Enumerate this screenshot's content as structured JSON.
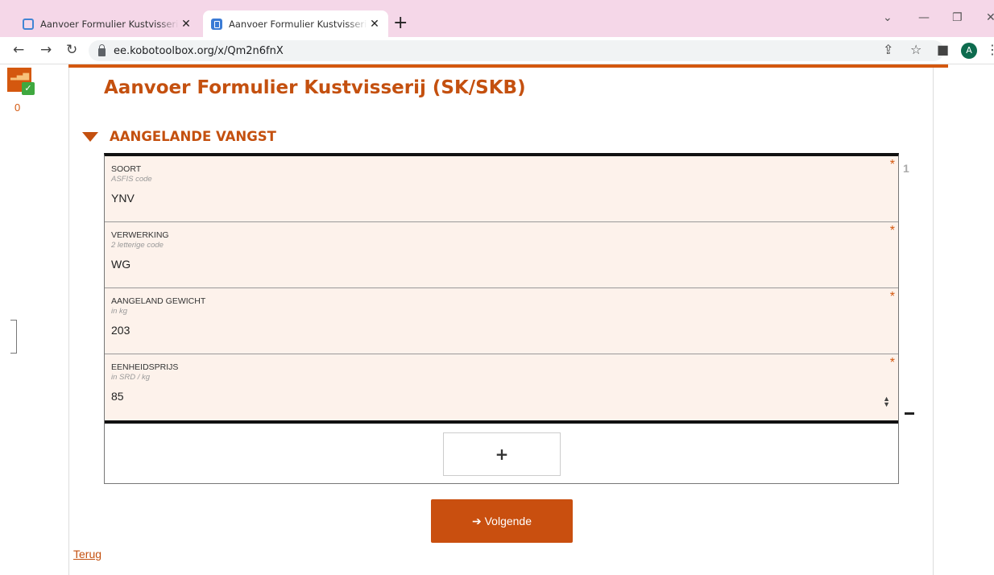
{
  "browser": {
    "tabs": [
      {
        "title": "Aanvoer Formulier Kustvisserij (SK",
        "close": "✕"
      },
      {
        "title": "Aanvoer Formulier Kustvisserij (SK",
        "close": "✕"
      }
    ],
    "new_tab": "+",
    "url": "ee.kobotoolbox.org/x/Qm2n6fnX",
    "avatar_letter": "A",
    "icons": [
      "back-icon",
      "forward-icon",
      "reload-icon",
      "lock-icon",
      "share-icon",
      "star-icon",
      "sidebar-icon",
      "menu-icon"
    ]
  },
  "sidebar": {
    "queue_count": "0"
  },
  "form": {
    "title": "Aanvoer Formulier Kustvisserij (SK/SKB)",
    "group_title": "AANGELANDE VANGST",
    "repeat_number": "1",
    "questions": [
      {
        "label": "SOORT",
        "hint": "ASFIS code",
        "value": "YNV",
        "required": "*"
      },
      {
        "label": "VERWERKING",
        "hint": "2 letterige code",
        "value": "WG",
        "required": "*"
      },
      {
        "label": "AANGELAND GEWICHT",
        "hint": "in kg",
        "value": "203",
        "required": "*"
      },
      {
        "label": "EENHEIDSPRIJS",
        "hint": "in SRD / kg",
        "value": "85",
        "required": "*"
      }
    ],
    "add_label": "+",
    "next_label": "➔ Volgende",
    "back_label": "Terug"
  },
  "colors": {
    "accent": "#c4500f",
    "question_bg": "#fdf2eb",
    "next_button": "#c94f0f"
  }
}
